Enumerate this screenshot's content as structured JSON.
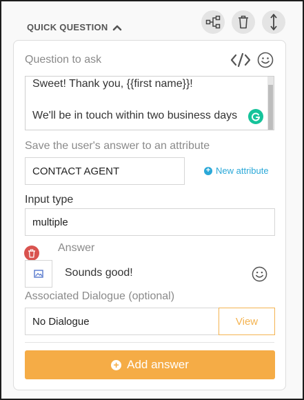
{
  "header": {
    "title": "QUICK QUESTION",
    "icons": [
      "chevron-up-icon",
      "flow-icon",
      "trash-icon",
      "move-vertical-icon"
    ]
  },
  "question": {
    "label": "Question to ask",
    "lines": [
      "Sweet! Thank you, {{first name}}!",
      "We'll be in touch within two business days"
    ]
  },
  "attribute": {
    "label": "Save the user's answer to an attribute",
    "value": "CONTACT AGENT",
    "new_link": "New attribute"
  },
  "input_type": {
    "label": "Input type",
    "value": "multiple"
  },
  "answer": {
    "label": "Answer",
    "value": "Sounds good!"
  },
  "dialogue": {
    "label": "Associated Dialogue (optional)",
    "value": "No Dialogue",
    "view_label": "View"
  },
  "add_answer_label": "Add answer",
  "colors": {
    "accent_orange": "#f5ac46",
    "link_blue": "#2aa8d8",
    "danger_red": "#d9534f",
    "grammarly_green": "#15c39a"
  }
}
